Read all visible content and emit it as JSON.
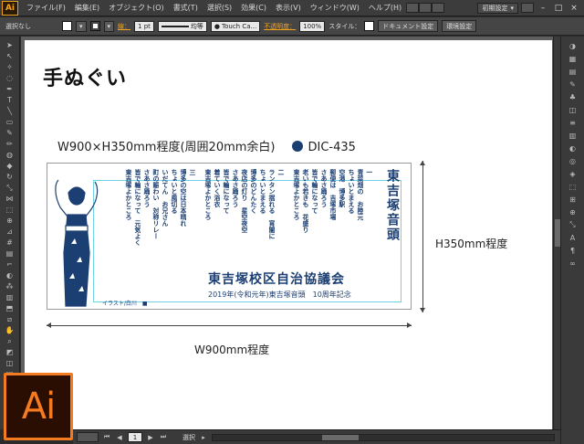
{
  "app": {
    "badge": "Ai",
    "logo_text": "Ai"
  },
  "menubar": {
    "items": [
      "ファイル(F)",
      "編集(E)",
      "オブジェクト(O)",
      "書式(T)",
      "選択(S)",
      "効果(C)",
      "表示(V)",
      "ウィンドウ(W)",
      "ヘルプ(H)"
    ],
    "workspace": "初期設定"
  },
  "controlbar": {
    "selection": "選択なし",
    "stroke_label": "線：",
    "stroke_weight": "1 pt",
    "stroke_profile": "均等",
    "brush": "Touch Ca...",
    "opacity_label": "不透明度：",
    "opacity_value": "100%",
    "style_label": "スタイル：",
    "doc_settings_button": "ドキュメント設定",
    "prefs_button": "環境設定"
  },
  "artwork": {
    "title": "手ぬぐい",
    "size_spec": "W900×H350mm程度(周囲20mm余白)",
    "color_spec": "DIC-435",
    "color_hex": "#1c3f73",
    "song_title": "東吉塚音頭",
    "org_name": "東吉塚校区自治協議会",
    "anniversary": "2019年(令和元年)東吉塚音頭　10周年記念",
    "credit": "イラスト/白川　■",
    "lyric_columns": [
      "一",
      "青菜畑の　お陸元",
      "ちょいとまえる",
      "空港　博多駅",
      "郵便は　吉塚市場",
      "さあさ踊ろう",
      "皆で輪になって",
      "老いも若きも　花盛り",
      "東吉塚よかところ",
      "",
      "二",
      "ランタン揺れる　宵闇に",
      "ちょいとまえる",
      "博多のどんたく",
      "夜店の灯り　星空夜空",
      "さあさ踊ろう",
      "皆で輪になって",
      "着ていく浴衣",
      "東吉塚よかところ",
      "",
      "三",
      "博多の空は日本晴れ",
      "ちょいと風切る",
      "いだてん　お兄さん",
      "町の賑わい　対称リレー",
      "さあさ踊ろう",
      "皆で輪になって　元気よく",
      "東吉塚よかところ"
    ],
    "width_label": "W900mm程度",
    "height_label": "H350mm程度"
  },
  "status": {
    "page": "1",
    "tool": "選択"
  },
  "toolbar": {
    "tools": [
      "selection-tool",
      "direct-selection-tool",
      "magic-wand-tool",
      "lasso-tool",
      "pen-tool",
      "type-tool",
      "line-tool",
      "rectangle-tool",
      "paintbrush-tool",
      "pencil-tool",
      "blob-brush-tool",
      "eraser-tool",
      "rotate-tool",
      "scale-tool",
      "width-tool",
      "free-transform-tool",
      "shape-builder-tool",
      "perspective-tool",
      "mesh-tool",
      "gradient-tool",
      "eyedropper-tool",
      "blend-tool",
      "symbol-sprayer-tool",
      "column-graph-tool",
      "artboard-tool",
      "slice-tool",
      "hand-tool",
      "zoom-tool"
    ]
  }
}
